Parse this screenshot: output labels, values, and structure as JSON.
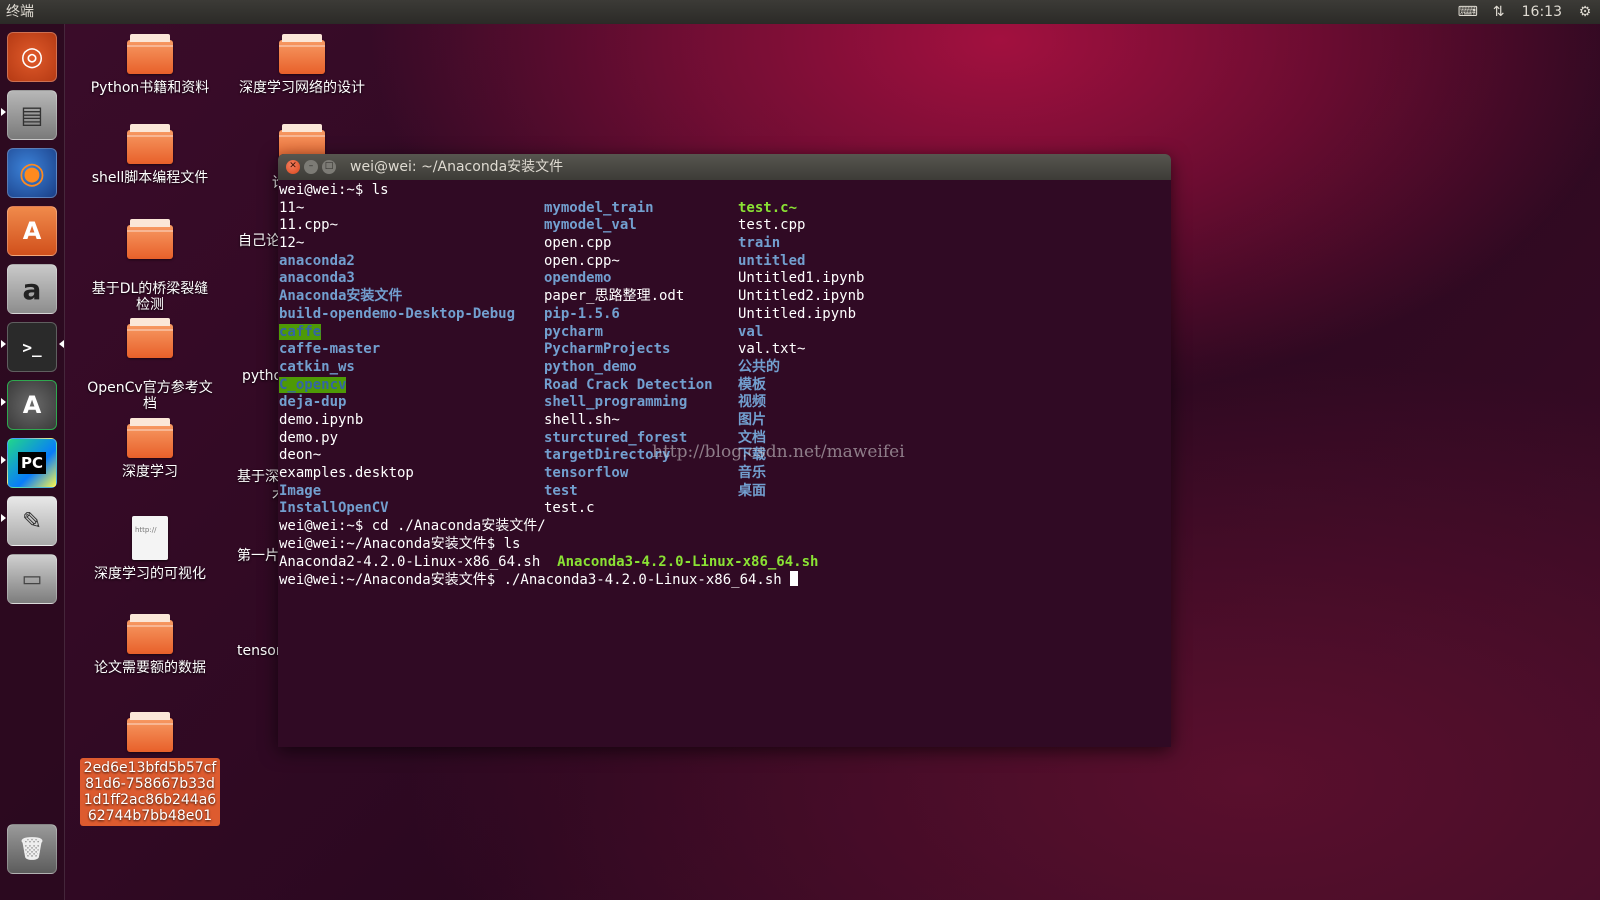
{
  "top_panel": {
    "app_name": "终端",
    "time": "16:13",
    "icons": [
      "keyboard-icon",
      "network-icon",
      "settings-gear-icon"
    ]
  },
  "launcher": {
    "items": [
      {
        "name": "ubuntu-dash",
        "glyph": "◎",
        "color": "#d9501f"
      },
      {
        "name": "files",
        "glyph": "▤",
        "color": "#8a8a8a"
      },
      {
        "name": "firefox",
        "glyph": "◉",
        "color": "#e66000"
      },
      {
        "name": "software-center",
        "glyph": "A",
        "color": "#e06a2c"
      },
      {
        "name": "amazon",
        "glyph": "a",
        "color": "#9a9a9a"
      },
      {
        "name": "terminal",
        "glyph": ">_",
        "color": "#2c2c2c"
      },
      {
        "name": "software-updater",
        "glyph": "A",
        "color": "#555555"
      },
      {
        "name": "pycharm",
        "glyph": "PC",
        "color": "#21d789"
      },
      {
        "name": "text-editor",
        "glyph": "✎",
        "color": "#cfcfcf"
      },
      {
        "name": "disk",
        "glyph": "▭",
        "color": "#9a9a9a"
      },
      {
        "name": "trash",
        "glyph": "🗑",
        "color": "#888888"
      }
    ]
  },
  "desktop": {
    "icons": [
      {
        "label": "Python书籍和资料",
        "type": "folder"
      },
      {
        "label": "深度学习网络的设计",
        "type": "folder"
      },
      {
        "label": "shell脚本编程文件",
        "type": "folder"
      },
      {
        "label": "基于DL的桥梁裂缝\n检测",
        "type": "folder"
      },
      {
        "label": "OpenCv官方参考文\n档",
        "type": "folder"
      },
      {
        "label": "深度学习",
        "type": "folder"
      },
      {
        "label": "深度学习的可视化",
        "type": "html",
        "file_text": "http://"
      },
      {
        "label": "论文需要额的数据",
        "type": "folder"
      },
      {
        "label": "2ed6e13bfd5b57cf81d6-758667b33d1d1ff2ac86b244a662744b7bb48e01",
        "type": "folder",
        "selected": true
      }
    ],
    "partial_labels": [
      "论",
      "自己论",
      "pytho",
      "基于深",
      "术",
      "第一片",
      "tensor"
    ]
  },
  "terminal": {
    "title": "wei@wei: ~/Anaconda安装文件",
    "line1": "wei@wei:~$ ls",
    "ls_col1": [
      {
        "t": "11~",
        "c": "plain"
      },
      {
        "t": "11.cpp~",
        "c": "plain"
      },
      {
        "t": "12~",
        "c": "plain"
      },
      {
        "t": "anaconda2",
        "c": "dir"
      },
      {
        "t": "anaconda3",
        "c": "dir"
      },
      {
        "t": "Anaconda安装文件",
        "c": "dir"
      },
      {
        "t": "build-opendemo-Desktop-Debug",
        "c": "dir"
      },
      {
        "t": "caffe",
        "c": "dir-hl"
      },
      {
        "t": "caffe-master",
        "c": "dir"
      },
      {
        "t": "catkin_ws",
        "c": "dir"
      },
      {
        "t": "C_opencv",
        "c": "dir-hl"
      },
      {
        "t": "deja-dup",
        "c": "dir"
      },
      {
        "t": "demo.ipynb",
        "c": "plain"
      },
      {
        "t": "demo.py",
        "c": "plain"
      },
      {
        "t": "deon~",
        "c": "plain"
      },
      {
        "t": "examples.desktop",
        "c": "plain"
      },
      {
        "t": "Image",
        "c": "dir"
      },
      {
        "t": "InstallOpenCV",
        "c": "dir"
      }
    ],
    "ls_col2": [
      {
        "t": "mymodel_train",
        "c": "dir"
      },
      {
        "t": "mymodel_val",
        "c": "dir"
      },
      {
        "t": "open.cpp",
        "c": "plain"
      },
      {
        "t": "open.cpp~",
        "c": "plain"
      },
      {
        "t": "opendemo",
        "c": "dir"
      },
      {
        "t": "paper_思路整理.odt",
        "c": "plain"
      },
      {
        "t": "pip-1.5.6",
        "c": "dir"
      },
      {
        "t": "pycharm",
        "c": "dir"
      },
      {
        "t": "PycharmProjects",
        "c": "dir"
      },
      {
        "t": "python_demo",
        "c": "dir"
      },
      {
        "t": "Road Crack Detection",
        "c": "dir"
      },
      {
        "t": "shell_programming",
        "c": "dir"
      },
      {
        "t": "shell.sh~",
        "c": "plain"
      },
      {
        "t": "sturctured_forest",
        "c": "dir"
      },
      {
        "t": "targetDirectory",
        "c": "dir"
      },
      {
        "t": "tensorflow",
        "c": "dir"
      },
      {
        "t": "test",
        "c": "dir"
      },
      {
        "t": "test.c",
        "c": "plain"
      }
    ],
    "ls_col3": [
      {
        "t": "",
        "c": "plain"
      },
      {
        "t": "test.c~",
        "c": "exe"
      },
      {
        "t": "test.cpp",
        "c": "plain"
      },
      {
        "t": "train",
        "c": "dir"
      },
      {
        "t": "untitled",
        "c": "dir"
      },
      {
        "t": "Untitled1.ipynb",
        "c": "plain"
      },
      {
        "t": "Untitled2.ipynb",
        "c": "plain"
      },
      {
        "t": "Untitled.ipynb",
        "c": "plain"
      },
      {
        "t": "val",
        "c": "dir"
      },
      {
        "t": "val.txt~",
        "c": "plain"
      },
      {
        "t": "公共的",
        "c": "dir"
      },
      {
        "t": "模板",
        "c": "dir"
      },
      {
        "t": "视频",
        "c": "dir"
      },
      {
        "t": "图片",
        "c": "dir"
      },
      {
        "t": "文档",
        "c": "dir"
      },
      {
        "t": "下载",
        "c": "dir"
      },
      {
        "t": "音乐",
        "c": "dir"
      },
      {
        "t": "桌面",
        "c": "dir"
      }
    ],
    "line_cd": "wei@wei:~$ cd ./Anaconda安装文件/",
    "line_ls2": "wei@wei:~/Anaconda安装文件$ ls",
    "ls2_file1": "Anaconda2-4.2.0-Linux-x86_64.sh",
    "ls2_file2": "Anaconda3-4.2.0-Linux-x86_64.sh",
    "line_run": "wei@wei:~/Anaconda安装文件$ ./Anaconda3-4.2.0-Linux-x86_64.sh ",
    "watermark": "http://blog.csdn.net/maweifei"
  }
}
